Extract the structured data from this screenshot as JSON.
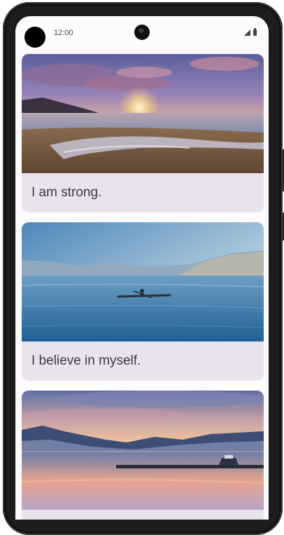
{
  "status_bar": {
    "time": "12:00",
    "icons": [
      "signal-icon",
      "battery-icon"
    ]
  },
  "affirmations": [
    {
      "text": "I am strong.",
      "image": "beach-sunset-photo"
    },
    {
      "text": "I believe in myself.",
      "image": "kayak-lake-photo"
    },
    {
      "text": "",
      "image": "mountain-lake-sunset-photo"
    }
  ],
  "colors": {
    "card_background": "#e9e3ee",
    "screen_background": "#fdfbfe",
    "text": "#3d3a42"
  }
}
